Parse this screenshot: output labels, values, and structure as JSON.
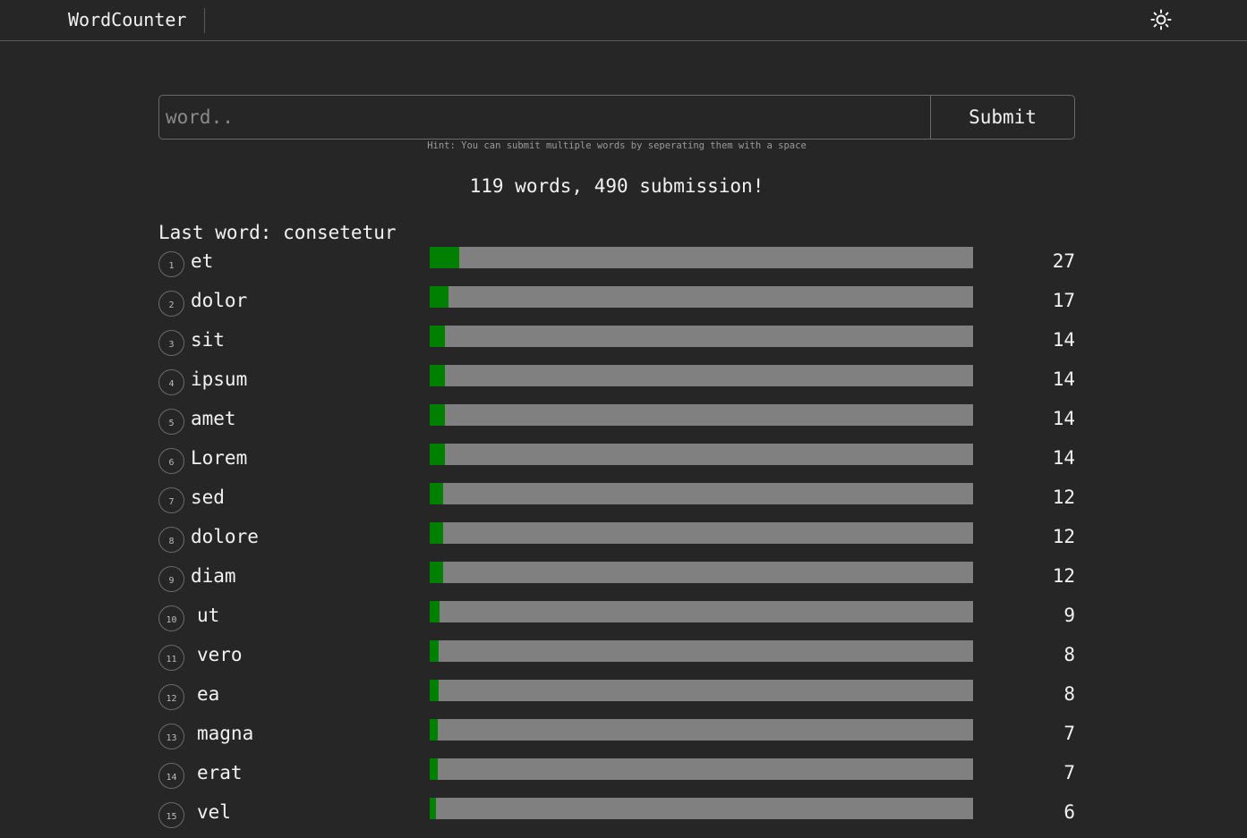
{
  "app": {
    "brand": "WordCounter",
    "theme_icon": "sun-icon"
  },
  "form": {
    "placeholder": "word..",
    "value": "",
    "submit_label": "Submit",
    "hint": "Hint: You can submit multiple words by seperating them with a space"
  },
  "stats": {
    "text": "119 words, 490 submission!",
    "total_words": 119,
    "total_submissions": 490
  },
  "last_word": {
    "text": "Last word: consetetur"
  },
  "colors": {
    "bar_fill": "#008000",
    "bar_track": "#808080",
    "background": "#262626"
  },
  "words": [
    {
      "rank": "1",
      "word": "et",
      "count": "27",
      "share": 0.0551
    },
    {
      "rank": "2",
      "word": "dolor",
      "count": "17",
      "share": 0.0347
    },
    {
      "rank": "3",
      "word": "sit",
      "count": "14",
      "share": 0.0286
    },
    {
      "rank": "4",
      "word": "ipsum",
      "count": "14",
      "share": 0.0286
    },
    {
      "rank": "5",
      "word": "amet",
      "count": "14",
      "share": 0.0286
    },
    {
      "rank": "6",
      "word": "Lorem",
      "count": "14",
      "share": 0.0286
    },
    {
      "rank": "7",
      "word": "sed",
      "count": "12",
      "share": 0.0245
    },
    {
      "rank": "8",
      "word": "dolore",
      "count": "12",
      "share": 0.0245
    },
    {
      "rank": "9",
      "word": "diam",
      "count": "12",
      "share": 0.0245
    },
    {
      "rank": "10",
      "word": "ut",
      "count": "9",
      "share": 0.0184
    },
    {
      "rank": "11",
      "word": "vero",
      "count": "8",
      "share": 0.0163
    },
    {
      "rank": "12",
      "word": "ea",
      "count": "8",
      "share": 0.0163
    },
    {
      "rank": "13",
      "word": "magna",
      "count": "7",
      "share": 0.0143
    },
    {
      "rank": "14",
      "word": "erat",
      "count": "7",
      "share": 0.0143
    },
    {
      "rank": "15",
      "word": "vel",
      "count": "6",
      "share": 0.0122
    }
  ]
}
